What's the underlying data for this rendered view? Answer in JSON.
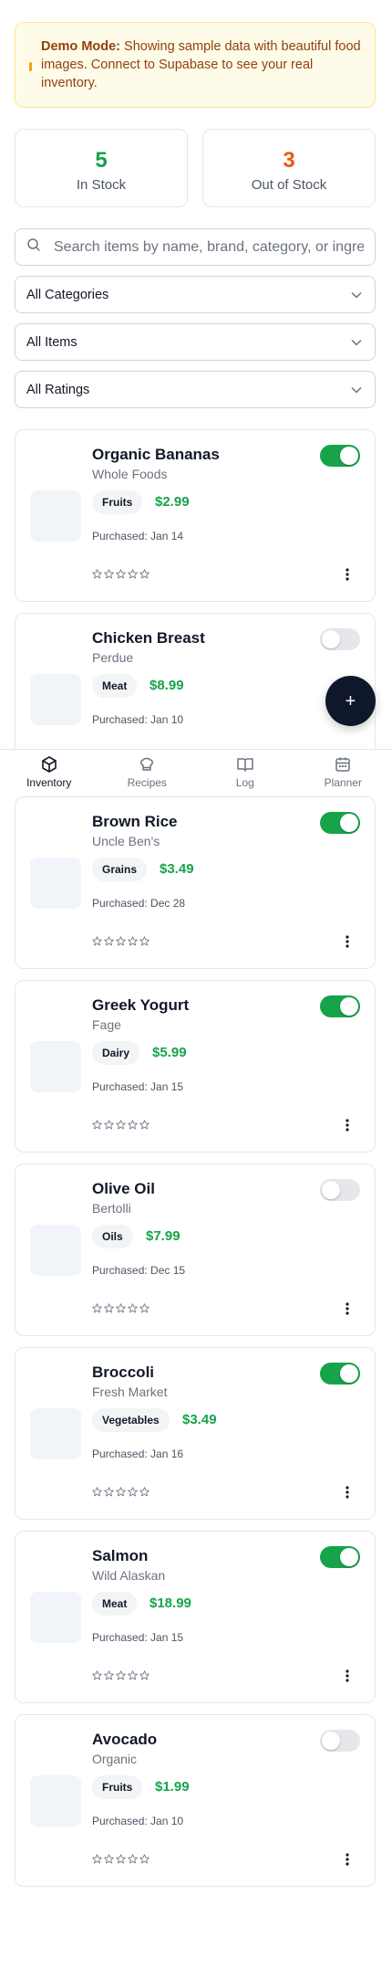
{
  "banner": {
    "title": "Demo Mode:",
    "text": " Showing sample data with beautiful food images. Connect to Supabase to see your real inventory."
  },
  "stats": {
    "in_stock": {
      "value": "5",
      "label": "In Stock",
      "color": "#16a34a"
    },
    "out_of_stock": {
      "value": "3",
      "label": "Out of Stock",
      "color": "#ea580c"
    }
  },
  "search": {
    "placeholder": "Search items by name, brand, category, or ingredients..."
  },
  "filters": {
    "categories": "All Categories",
    "items": "All Items",
    "ratings": "All Ratings"
  },
  "items": [
    {
      "name": "Organic Bananas",
      "brand": "Whole Foods",
      "category": "Fruits",
      "price": "$2.99",
      "purchased": "Purchased: Jan 14",
      "in_stock": true,
      "rating": 0
    },
    {
      "name": "Chicken Breast",
      "brand": "Perdue",
      "category": "Meat",
      "price": "$8.99",
      "purchased": "Purchased: Jan 10",
      "in_stock": false,
      "rating": 0
    },
    {
      "name": "Brown Rice",
      "brand": "Uncle Ben's",
      "category": "Grains",
      "price": "$3.49",
      "purchased": "Purchased: Dec 28",
      "in_stock": true,
      "rating": 0
    },
    {
      "name": "Greek Yogurt",
      "brand": "Fage",
      "category": "Dairy",
      "price": "$5.99",
      "purchased": "Purchased: Jan 15",
      "in_stock": true,
      "rating": 0
    },
    {
      "name": "Olive Oil",
      "brand": "Bertolli",
      "category": "Oils",
      "price": "$7.99",
      "purchased": "Purchased: Dec 15",
      "in_stock": false,
      "rating": 0
    },
    {
      "name": "Broccoli",
      "brand": "Fresh Market",
      "category": "Vegetables",
      "price": "$3.49",
      "purchased": "Purchased: Jan 16",
      "in_stock": true,
      "rating": 0
    },
    {
      "name": "Salmon",
      "brand": "Wild Alaskan",
      "category": "Meat",
      "price": "$18.99",
      "purchased": "Purchased: Jan 15",
      "in_stock": true,
      "rating": 0
    },
    {
      "name": "Avocado",
      "brand": "Organic",
      "category": "Fruits",
      "price": "$1.99",
      "purchased": "Purchased: Jan 10",
      "in_stock": false,
      "rating": 0
    }
  ],
  "fab": {
    "label": "+"
  },
  "nav": [
    {
      "label": "Inventory",
      "icon": "box-icon",
      "active": true
    },
    {
      "label": "Recipes",
      "icon": "chef-hat-icon",
      "active": false
    },
    {
      "label": "Log",
      "icon": "book-open-icon",
      "active": false
    },
    {
      "label": "Planner",
      "icon": "calendar-icon",
      "active": false
    }
  ]
}
